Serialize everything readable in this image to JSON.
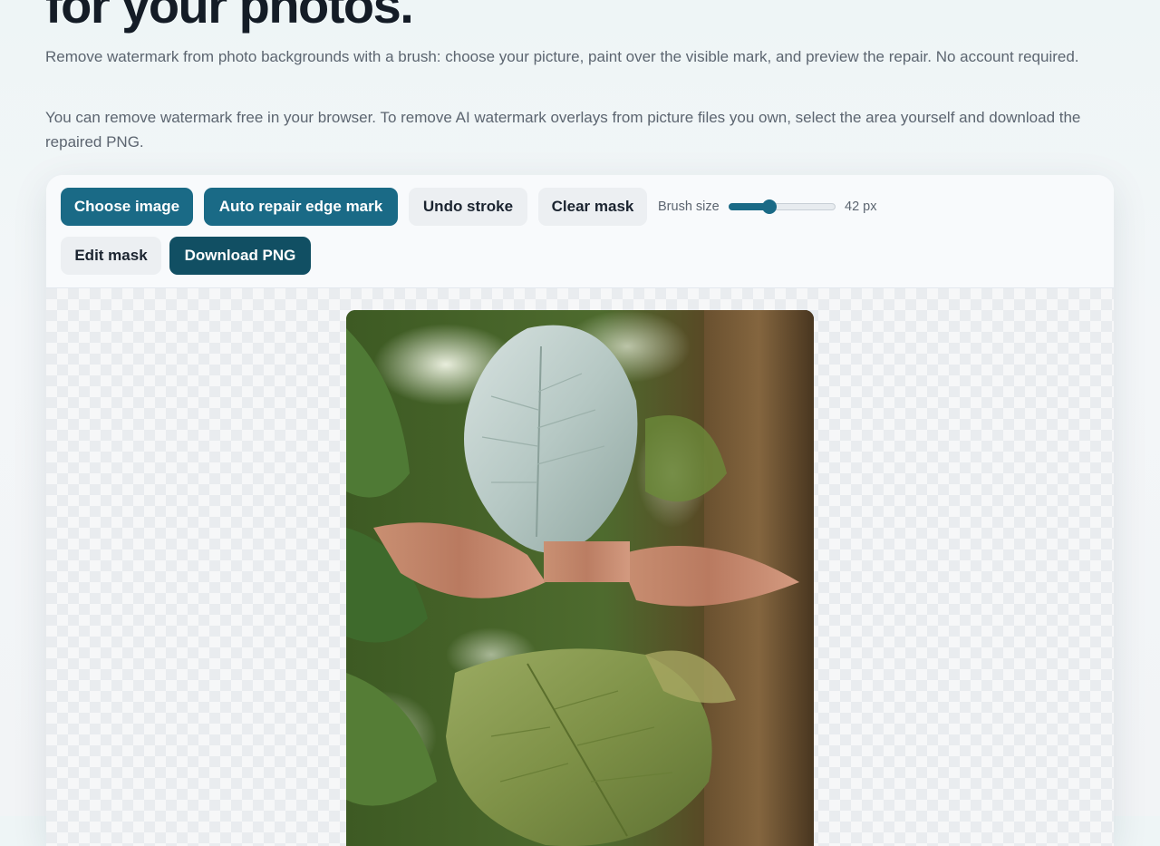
{
  "hero": {
    "title": "for your photos."
  },
  "intro": {
    "paragraph1": "Remove watermark from photo backgrounds with a brush: choose your picture, paint over the visible mark, and preview the repair. No account required.",
    "paragraph2": "You can remove watermark free in your browser. To remove AI watermark overlays from picture files you own, select the area yourself and download the repaired PNG."
  },
  "toolbar": {
    "choose_image": "Choose image",
    "auto_repair": "Auto repair edge mark",
    "undo_stroke": "Undo stroke",
    "clear_mask": "Clear mask",
    "brush_size_label": "Brush size",
    "brush_size_value": "42 px",
    "brush_size_fraction": 0.38,
    "edit_mask": "Edit mask",
    "download_png": "Download PNG"
  },
  "colors": {
    "primary": "#1a6a86",
    "dark": "#114f63",
    "ghost": "#eceff2"
  },
  "canvas": {
    "image_description_icon": "photo-preview"
  }
}
